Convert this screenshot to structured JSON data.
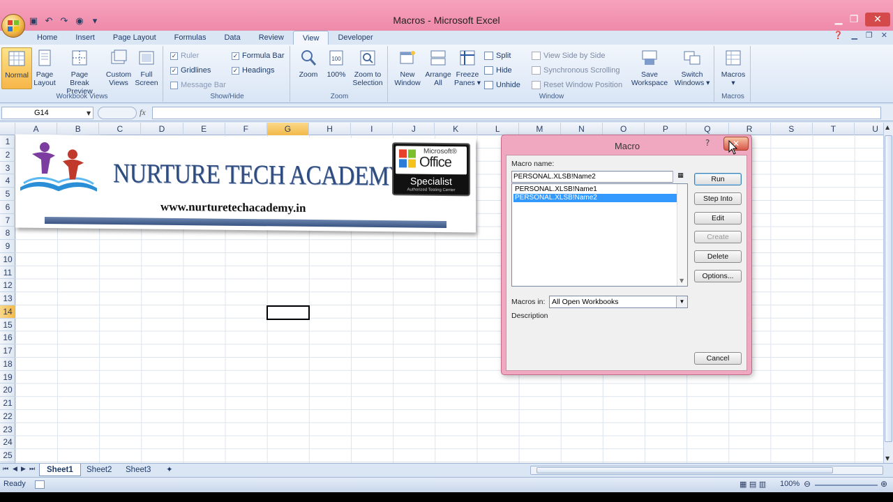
{
  "window": {
    "title": "Macros - Microsoft Excel"
  },
  "ribbon_tabs": [
    "Home",
    "Insert",
    "Page Layout",
    "Formulas",
    "Data",
    "Review",
    "View",
    "Developer"
  ],
  "active_tab": "View",
  "ribbon": {
    "workbook_views": {
      "label": "Workbook Views",
      "buttons": [
        {
          "line1": "Normal",
          "line2": ""
        },
        {
          "line1": "Page",
          "line2": "Layout"
        },
        {
          "line1": "Page Break",
          "line2": "Preview"
        },
        {
          "line1": "Custom",
          "line2": "Views"
        },
        {
          "line1": "Full",
          "line2": "Screen"
        }
      ]
    },
    "show_hide": {
      "label": "Show/Hide",
      "ruler": "Ruler",
      "gridlines": "Gridlines",
      "message_bar": "Message Bar",
      "formula_bar": "Formula Bar",
      "headings": "Headings"
    },
    "zoom": {
      "label": "Zoom",
      "buttons": [
        {
          "line1": "Zoom",
          "line2": ""
        },
        {
          "line1": "100%",
          "line2": ""
        },
        {
          "line1": "Zoom to",
          "line2": "Selection"
        }
      ]
    },
    "window": {
      "label": "Window",
      "new_window": [
        "New",
        "Window"
      ],
      "arrange_all": [
        "Arrange",
        "All"
      ],
      "freeze_panes": [
        "Freeze",
        "Panes ▾"
      ],
      "split": "Split",
      "hide": "Hide",
      "unhide": "Unhide",
      "side_by_side": "View Side by Side",
      "sync_scroll": "Synchronous Scrolling",
      "reset_pos": "Reset Window Position",
      "save_workspace": [
        "Save",
        "Workspace"
      ],
      "switch_windows": [
        "Switch",
        "Windows ▾"
      ]
    },
    "macros": {
      "label": "Macros",
      "button": "Macros"
    }
  },
  "formula_bar": {
    "name_box": "G14",
    "fx": "fx"
  },
  "columns": [
    "A",
    "B",
    "C",
    "D",
    "E",
    "F",
    "G",
    "H",
    "I",
    "J",
    "K",
    "L",
    "M",
    "N",
    "O",
    "P",
    "Q",
    "R",
    "S",
    "T",
    "U"
  ],
  "rows": [
    "1",
    "2",
    "3",
    "4",
    "5",
    "6",
    "7",
    "8",
    "9",
    "10",
    "11",
    "12",
    "13",
    "14",
    "15",
    "16",
    "17",
    "18",
    "19",
    "20",
    "21",
    "22",
    "23",
    "24",
    "25"
  ],
  "selected_cell": {
    "col": "G",
    "row": "14"
  },
  "banner": {
    "title": "NURTURE TECH ACADEMY",
    "url": "www.nurturetechacademy.in",
    "badge_brand": "Microsoft®",
    "badge_office": "Office",
    "badge_specialist": "Specialist",
    "badge_sub": "Authorized Testing Center"
  },
  "sheets": [
    "Sheet1",
    "Sheet2",
    "Sheet3"
  ],
  "active_sheet": "Sheet1",
  "status": {
    "text": "Ready",
    "zoom": "100%"
  },
  "dialog": {
    "title": "Macro",
    "help": "?",
    "close": "✕",
    "macro_name_label": "Macro name:",
    "macro_name_value": "PERSONAL.XLSB!Name2",
    "macros": [
      "PERSONAL.XLSB!Name1",
      "PERSONAL.XLSB!Name2"
    ],
    "selected_macro": "PERSONAL.XLSB!Name2",
    "buttons": {
      "run": "Run",
      "step_into": "Step Into",
      "edit": "Edit",
      "create": "Create",
      "delete": "Delete",
      "options": "Options...",
      "cancel": "Cancel"
    },
    "macros_in_label": "Macros in:",
    "macros_in_value": "All Open Workbooks",
    "description_label": "Description"
  }
}
